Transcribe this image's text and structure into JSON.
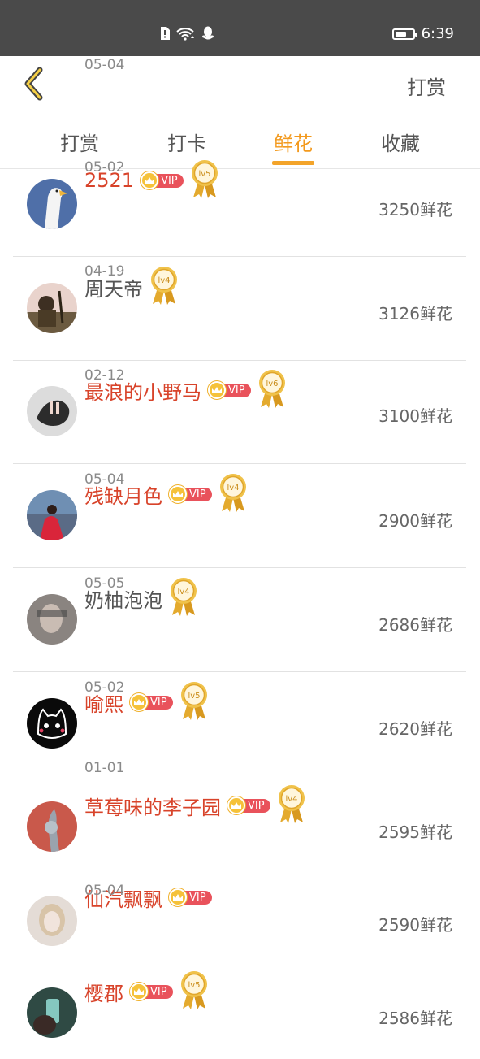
{
  "status_bar": {
    "time": "6:39",
    "battery_level": 0.65,
    "icons": [
      "sim-alert-icon",
      "wifi-icon",
      "qq-icon"
    ]
  },
  "header": {
    "back_icon": "chevron-left-icon",
    "action_label": "打赏"
  },
  "tabs": [
    {
      "label": "打赏",
      "active": false
    },
    {
      "label": "打卡",
      "active": false
    },
    {
      "label": "鲜花",
      "active": true
    },
    {
      "label": "收藏",
      "active": false
    }
  ],
  "colors": {
    "accent": "#f39a1e",
    "vip_name": "#d8432a",
    "vip_badge": "#e9525b",
    "crown": "#f5c23a",
    "medal": "#e0a62b"
  },
  "vip_label": "VIP",
  "entries": [
    {
      "name": "2521",
      "vip": true,
      "level": "lv5",
      "date": "05-04",
      "amount": "3250鲜花",
      "avatar": "goose-avatar"
    },
    {
      "name": "周天帝",
      "vip": false,
      "level": "lv4",
      "date": "05-02",
      "amount": "3126鲜花",
      "avatar": "warrior-avatar"
    },
    {
      "name": "最浪的小野马",
      "vip": true,
      "level": "lv6",
      "date": "04-19",
      "amount": "3100鲜花",
      "avatar": "hand-avatar"
    },
    {
      "name": "残缺月色",
      "vip": true,
      "level": "lv4",
      "date": "02-12",
      "amount": "2900鲜花",
      "avatar": "red-dress-avatar"
    },
    {
      "name": "奶柚泡泡",
      "vip": false,
      "level": "lv4",
      "date": "05-04",
      "amount": "2686鲜花",
      "avatar": "blurred-avatar"
    },
    {
      "name": "喻熙",
      "vip": true,
      "level": "lv5",
      "date": "05-05",
      "amount": "2620鲜花",
      "avatar": "cat-avatar"
    },
    {
      "name": "草莓味的李子园",
      "vip": true,
      "level": "lv4",
      "date": "05-02",
      "amount": "2595鲜花",
      "avatar": "bunny-avatar"
    },
    {
      "name": "仙汽飘飘",
      "vip": true,
      "level": "",
      "date": "01-01",
      "amount": "2590鲜花",
      "avatar": "blonde-avatar"
    },
    {
      "name": "樱郡",
      "vip": true,
      "level": "lv5",
      "date": "05-04",
      "amount": "2586鲜花",
      "avatar": "phone-avatar"
    }
  ]
}
